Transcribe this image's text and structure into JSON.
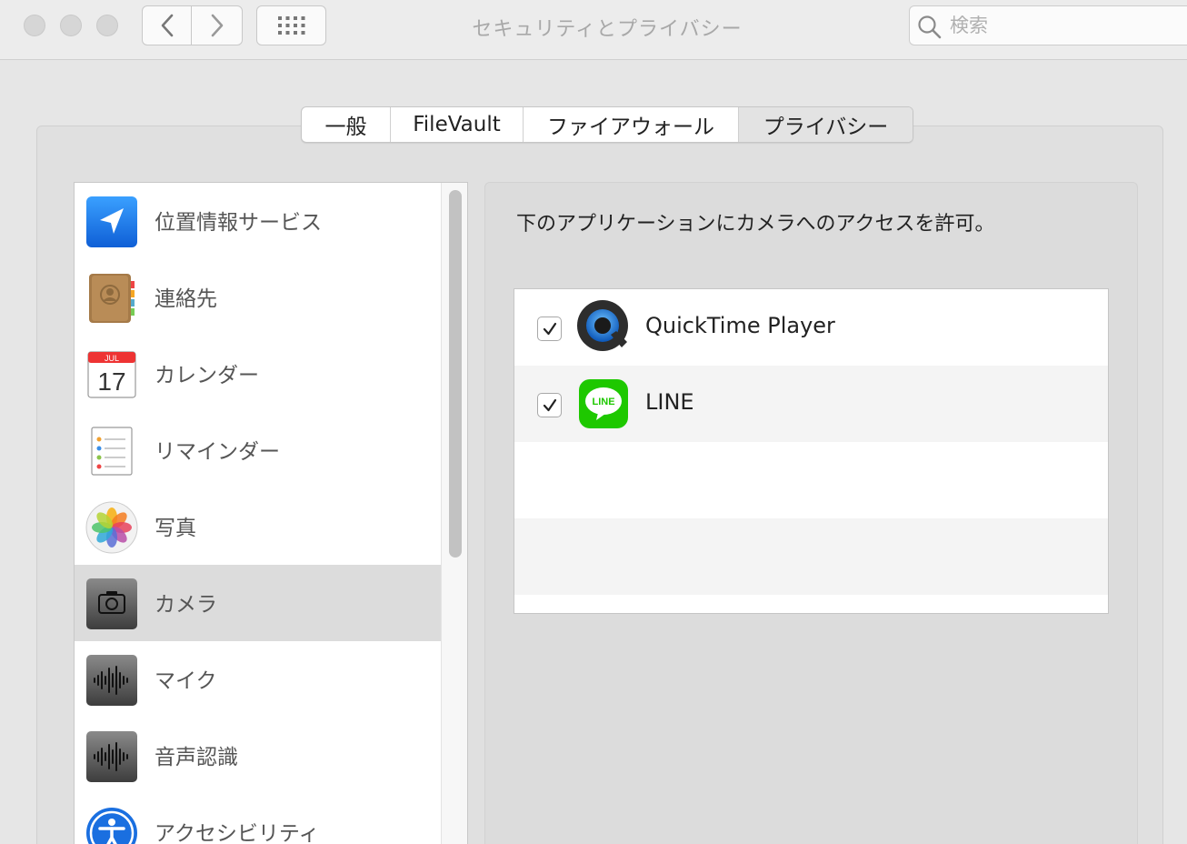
{
  "window": {
    "title": "セキュリティとプライバシー",
    "search_placeholder": "検索"
  },
  "tabs": [
    {
      "label": "一般",
      "active": false
    },
    {
      "label": "FileVault",
      "active": false
    },
    {
      "label": "ファイアウォール",
      "active": false
    },
    {
      "label": "プライバシー",
      "active": true
    }
  ],
  "sidebar": {
    "items": [
      {
        "label": "位置情報サービス",
        "icon": "location-arrow-icon",
        "selected": false
      },
      {
        "label": "連絡先",
        "icon": "contacts-book-icon",
        "selected": false
      },
      {
        "label": "カレンダー",
        "icon": "calendar-icon",
        "selected": false,
        "icon_text": {
          "month": "JUL",
          "day": "17"
        }
      },
      {
        "label": "リマインダー",
        "icon": "reminders-icon",
        "selected": false
      },
      {
        "label": "写真",
        "icon": "photos-flower-icon",
        "selected": false
      },
      {
        "label": "カメラ",
        "icon": "camera-icon",
        "selected": true
      },
      {
        "label": "マイク",
        "icon": "microphone-waveform-icon",
        "selected": false
      },
      {
        "label": "音声認識",
        "icon": "speech-waveform-icon",
        "selected": false
      },
      {
        "label": "アクセシビリティ",
        "icon": "accessibility-icon",
        "selected": false
      }
    ]
  },
  "detail": {
    "description": "下のアプリケーションにカメラへのアクセスを許可。",
    "apps": [
      {
        "name": "QuickTime Player",
        "checked": true,
        "icon": "quicktime-icon"
      },
      {
        "name": "LINE",
        "checked": true,
        "icon": "line-app-icon",
        "icon_text": "LINE"
      }
    ]
  },
  "colors": {
    "location_blue": "#1a7ff0",
    "line_green": "#1ec800",
    "selected_row": "#dcdcdc"
  }
}
